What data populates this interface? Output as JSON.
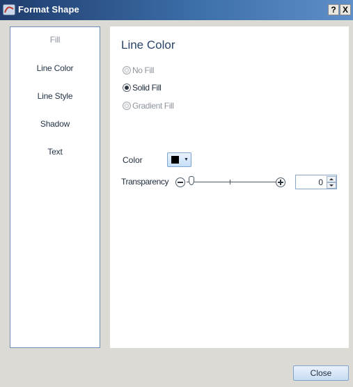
{
  "window": {
    "title": "Format Shape",
    "help_label": "?",
    "close_label": "X"
  },
  "nav": {
    "items": [
      {
        "label": "Fill",
        "muted": true
      },
      {
        "label": "Line Color"
      },
      {
        "label": "Line Style"
      },
      {
        "label": "Shadow"
      },
      {
        "label": "Text"
      }
    ]
  },
  "content": {
    "title": "Line Color",
    "options": [
      {
        "label": "No Fill",
        "state": "disabled"
      },
      {
        "label": "Solid Fill",
        "state": "checked"
      },
      {
        "label": "Gradient Fill",
        "state": "disabled"
      }
    ],
    "color_label": "Color",
    "color_value": "#000000",
    "transparency_label": "Transparency",
    "transparency_value": "0"
  },
  "footer": {
    "close_label": "Close"
  },
  "colors": {
    "titlebar_start": "#1f3c6d",
    "titlebar_end": "#5f8fc8",
    "accent": "#7fa3ce"
  }
}
